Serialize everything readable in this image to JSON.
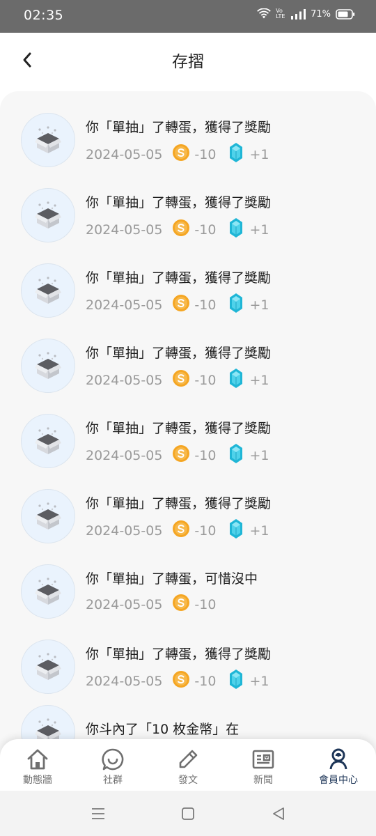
{
  "status_bar": {
    "time": "02:35",
    "battery": "71%",
    "network_label": "VoLTE"
  },
  "header": {
    "title": "存摺"
  },
  "records": [
    {
      "title": "你「單抽」了轉蛋，獲得了獎勵",
      "date": "2024-05-05",
      "coin": "-10",
      "gem": "+1"
    },
    {
      "title": "你「單抽」了轉蛋，獲得了獎勵",
      "date": "2024-05-05",
      "coin": "-10",
      "gem": "+1"
    },
    {
      "title": "你「單抽」了轉蛋，獲得了獎勵",
      "date": "2024-05-05",
      "coin": "-10",
      "gem": "+1"
    },
    {
      "title": "你「單抽」了轉蛋，獲得了獎勵",
      "date": "2024-05-05",
      "coin": "-10",
      "gem": "+1"
    },
    {
      "title": "你「單抽」了轉蛋，獲得了獎勵",
      "date": "2024-05-05",
      "coin": "-10",
      "gem": "+1"
    },
    {
      "title": "你「單抽」了轉蛋，獲得了獎勵",
      "date": "2024-05-05",
      "coin": "-10",
      "gem": "+1"
    },
    {
      "title": "你「單抽」了轉蛋，可惜沒中",
      "date": "2024-05-05",
      "coin": "-10",
      "gem": null
    },
    {
      "title": "你「單抽」了轉蛋，獲得了獎勵",
      "date": "2024-05-05",
      "coin": "-10",
      "gem": "+1"
    },
    {
      "title": "你斗內了「10 枚金幣」在",
      "date": "",
      "coin": "",
      "gem": null
    }
  ],
  "tabs": [
    {
      "label": "動態牆",
      "icon": "home-icon",
      "active": false
    },
    {
      "label": "社群",
      "icon": "chat-icon",
      "active": false
    },
    {
      "label": "發文",
      "icon": "pencil-icon",
      "active": false
    },
    {
      "label": "新聞",
      "icon": "news-icon",
      "active": false
    },
    {
      "label": "會員中心",
      "icon": "member-icon",
      "active": true
    }
  ],
  "colors": {
    "coin": "#f5a623",
    "gem": "#1fb6d6",
    "active_tab": "#1d3557",
    "status_bar": "#6b6b6b"
  }
}
